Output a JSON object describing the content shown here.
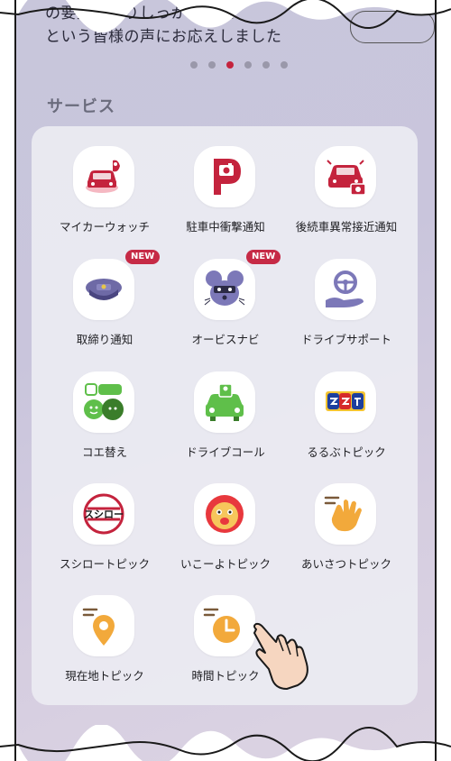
{
  "banner": {
    "line1": "の要望をよりしっかり数値",
    "line2": "という皆様の声にお応えしました"
  },
  "carousel": {
    "count": 6,
    "active_index": 2
  },
  "section": {
    "title": "サービス"
  },
  "services": [
    {
      "label": "マイカーウォッチ",
      "icon": "car-alert-icon",
      "new": false
    },
    {
      "label": "駐車中衝撃通知",
      "icon": "parking-camera-icon",
      "new": false
    },
    {
      "label": "後続車異常接近通知",
      "icon": "rear-car-camera-icon",
      "new": false
    },
    {
      "label": "取締り通知",
      "icon": "police-cap-icon",
      "new": true
    },
    {
      "label": "オービスナビ",
      "icon": "mouse-mascot-icon",
      "new": true
    },
    {
      "label": "ドライブサポート",
      "icon": "steering-hand-icon",
      "new": false
    },
    {
      "label": "コエ替え",
      "icon": "voice-change-icon",
      "new": false
    },
    {
      "label": "ドライブコール",
      "icon": "car-call-icon",
      "new": false
    },
    {
      "label": "るるぶトピック",
      "icon": "rurubu-logo-icon",
      "new": false
    },
    {
      "label": "スシロートピック",
      "icon": "sushiro-logo-icon",
      "new": false
    },
    {
      "label": "いこーよトピック",
      "icon": "ikoyo-face-icon",
      "new": false
    },
    {
      "label": "あいさつトピック",
      "icon": "waving-hand-icon",
      "new": false
    },
    {
      "label": "現在地トピック",
      "icon": "location-pin-icon",
      "new": false
    },
    {
      "label": "時間トピック",
      "icon": "clock-icon",
      "new": false
    }
  ],
  "badge_text": "NEW",
  "colors": {
    "accent_red": "#c4233d",
    "brand_purple": "#7c78b8",
    "green": "#5fbf4a",
    "orange": "#f2a93b"
  }
}
